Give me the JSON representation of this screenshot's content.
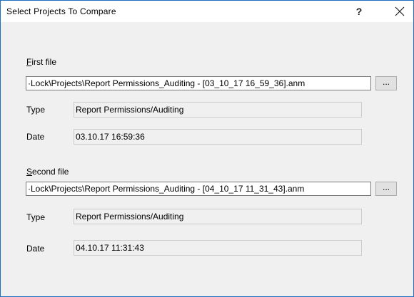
{
  "dialog": {
    "title": "Select Projects To Compare",
    "help_glyph": "?",
    "close_icon": "close-icon"
  },
  "first": {
    "label_mnemonic": "F",
    "label_rest": "irst file",
    "path": "·Lock\\Projects\\Report Permissions_Auditing - [03_10_17 16_59_36].anm",
    "browse_label": "...",
    "type_label": "Type",
    "type_value": "Report Permissions/Auditing",
    "date_label": "Date",
    "date_value": "03.10.17 16:59:36"
  },
  "second": {
    "label_mnemonic": "S",
    "label_rest": "econd file",
    "path": "·Lock\\Projects\\Report Permissions_Auditing - [04_10_17 11_31_43].anm",
    "browse_label": "...",
    "type_label": "Type",
    "type_value": "Report Permissions/Auditing",
    "date_label": "Date",
    "date_value": "04.10.17 11:31:43"
  },
  "colors": {
    "window_border": "#1e6fbf",
    "background": "#f0f0f0",
    "titlebar": "#ffffff"
  }
}
